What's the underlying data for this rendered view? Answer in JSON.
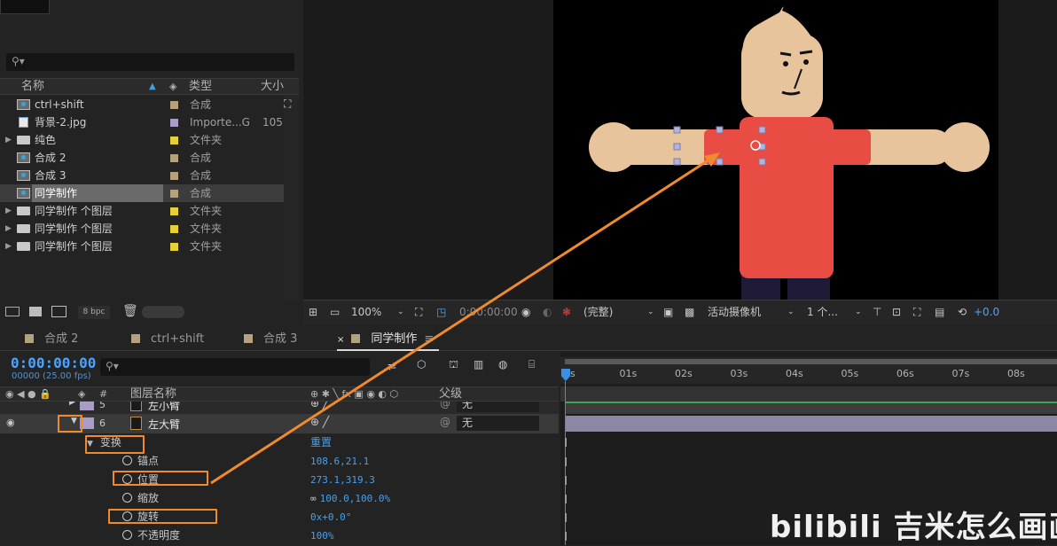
{
  "project": {
    "header": {
      "name": "名称",
      "type": "类型",
      "size": "大小"
    },
    "items": [
      {
        "name": "ctrl+shift",
        "type": "合成",
        "size": "",
        "icon": "comp-icon",
        "label_color": "#b4a17e"
      },
      {
        "name": "背景-2.jpg",
        "type": "Importe...G",
        "size": "105",
        "icon": "image-icon",
        "label_color": "#a99dc8"
      },
      {
        "name": "纯色",
        "type": "文件夹",
        "size": "",
        "icon": "folder-icon",
        "label_color": "#e6d03a"
      },
      {
        "name": "合成 2",
        "type": "合成",
        "size": "",
        "icon": "comp-icon",
        "label_color": "#b4a17e"
      },
      {
        "name": "合成 3",
        "type": "合成",
        "size": "",
        "icon": "comp-icon",
        "label_color": "#b4a17e"
      },
      {
        "name": "同学制作",
        "type": "合成",
        "size": "",
        "icon": "comp-icon",
        "label_color": "#b4a17e",
        "selected": true
      },
      {
        "name": "同学制作 个图层",
        "type": "文件夹",
        "size": "",
        "icon": "folder-icon",
        "label_color": "#e6d03a"
      },
      {
        "name": "同学制作 个图层",
        "type": "文件夹",
        "size": "",
        "icon": "folder-icon",
        "label_color": "#e6d03a"
      },
      {
        "name": "同学制作 个图层",
        "type": "文件夹",
        "size": "",
        "icon": "folder-icon",
        "label_color": "#e6d03a"
      }
    ],
    "footer": {
      "bpc": "8 bpc"
    }
  },
  "viewer": {
    "zoom": "100%",
    "timecode": "0:00:00:00",
    "resolution": "(完整)",
    "camera": "活动摄像机",
    "views": "1 个...",
    "exposure": "+0.0"
  },
  "timeline": {
    "tabs": [
      "合成 2",
      "ctrl+shift",
      "合成 3",
      "同学制作"
    ],
    "active_tab": "同学制作",
    "timecode": "0:00:00:00",
    "fps": "00000 (25.00 fps)",
    "columns": {
      "num": "#",
      "name": "图层名称",
      "parent": "父级"
    },
    "layers": [
      {
        "num": "5",
        "name": "左小臂",
        "parent": "无"
      },
      {
        "num": "6",
        "name": "左大臂",
        "parent": "无"
      }
    ],
    "transform": {
      "label": "变换",
      "reset": "重置"
    },
    "properties": [
      {
        "name": "锚点",
        "value": "108.6,21.1"
      },
      {
        "name": "位置",
        "value": "273.1,319.3"
      },
      {
        "name": "缩放",
        "value": "100.0,100.0%"
      },
      {
        "name": "旋转",
        "value": "0x+0.0°"
      },
      {
        "name": "不透明度",
        "value": "100%"
      }
    ],
    "ruler": [
      "0s",
      "01s",
      "02s",
      "03s",
      "04s",
      "05s",
      "06s",
      "07s",
      "08s"
    ]
  },
  "watermark": "bilibili 吉米怎么画画",
  "colors": {
    "accent": "#4a9fe8",
    "highlight_box": "#f08a2c",
    "shirt": "#e84c43",
    "skin": "#e8c49c"
  }
}
